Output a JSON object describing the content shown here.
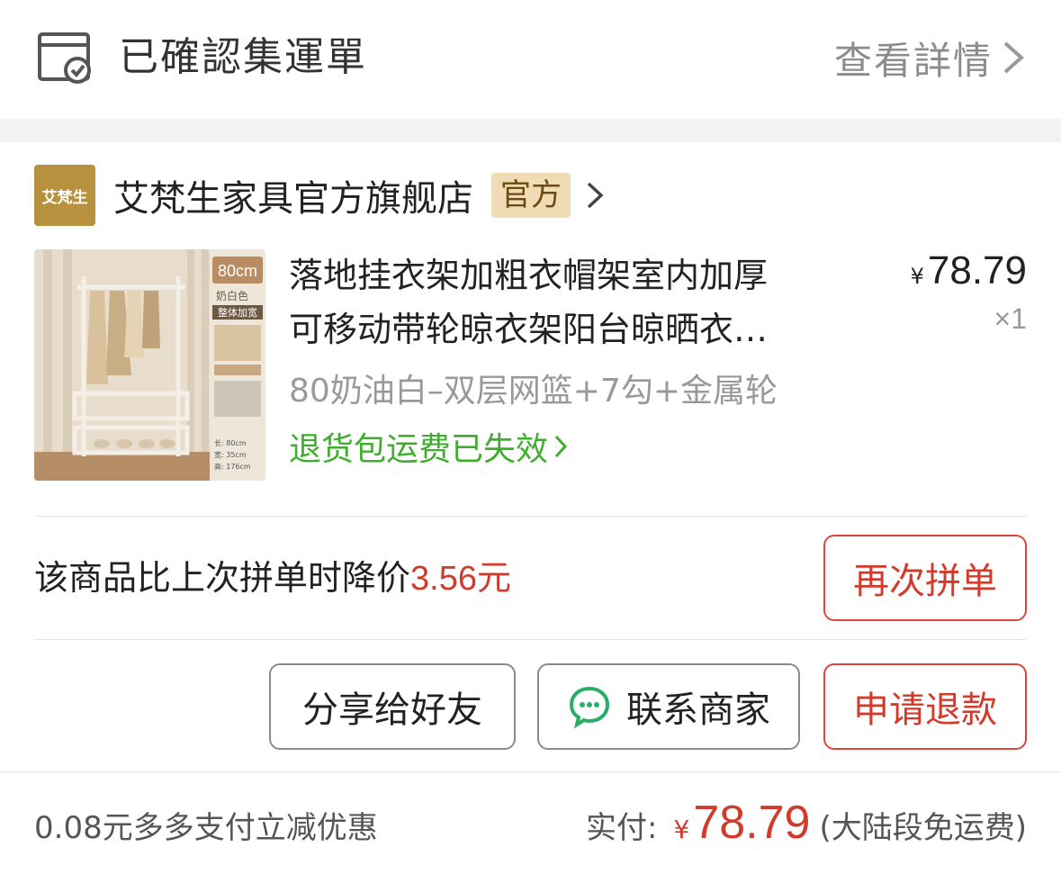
{
  "shipping": {
    "title": "已確認集運單",
    "detail_label": "查看詳情"
  },
  "store": {
    "logo_text": "艾梵生",
    "name": "艾梵生家具官方旗舰店",
    "badge": "官方"
  },
  "product": {
    "title_line1": "落地挂衣架加粗衣帽架室内加厚",
    "title_line2": "可移动带轮晾衣架阳台晾晒衣…",
    "price_unit": "¥",
    "price": "78.79",
    "quantity": "×1",
    "spec": "80奶油白–双层网篮+7勾+金属轮",
    "return_note": "退货包运费已失效",
    "image_texts": {
      "size_tag": "80cm",
      "color_tag": "奶白色",
      "feature_tag": "整体加宽",
      "dim_length": "长: 80cm",
      "dim_width": "宽: 35cm",
      "dim_height": "高: 176cm"
    }
  },
  "price_drop": {
    "text": "该商品比上次拼单时降价",
    "amount": "3.56元"
  },
  "buttons": {
    "reorder": "再次拼单",
    "share": "分享给好友",
    "contact": "联系商家",
    "refund": "申请退款"
  },
  "footer": {
    "promo": "0.08元多多支付立减优惠",
    "paid_label": "实付:",
    "paid_unit": "¥",
    "paid_amount": "78.79",
    "paid_note": "(大陆段免运费)"
  },
  "colors": {
    "accent_red": "#d23b2b",
    "green": "#3fae2e",
    "wechat_green": "#2aae67",
    "badge_bg": "#f0dcb4",
    "logo_bg": "#b8913f"
  },
  "icons": {
    "shipping": "shipping-box-check-icon",
    "chevron": "chevron-right-icon",
    "wechat": "wechat-icon"
  }
}
